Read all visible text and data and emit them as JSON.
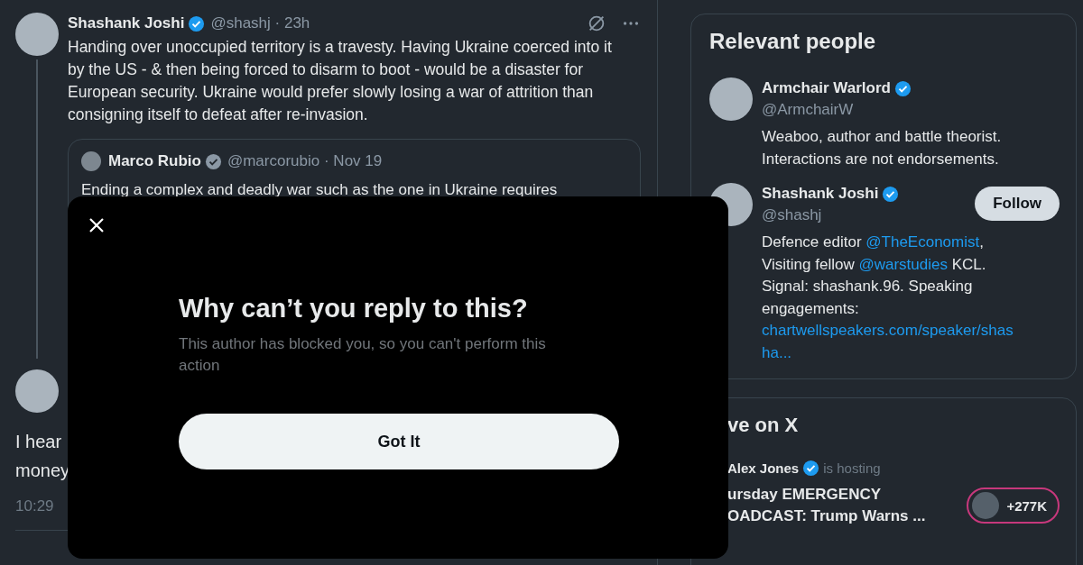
{
  "tweet": {
    "name": "Shashank Joshi",
    "verified": true,
    "meta": "@shashj · 23h",
    "text": "Handing over unoccupied territory is a travesty. Having Ukraine coerced into it by the US - & then being forced to disarm to boot - would be a disaster for European security. Ukraine would prefer slowly losing a war of attrition than consigning itself to defeat after re-invasion.",
    "quote": {
      "name": "Marco Rubio",
      "verified": true,
      "meta": "@marcorubio · Nov 19",
      "text": "Ending a complex and deadly war such as the one in Ukraine requires"
    }
  },
  "reply": {
    "lines": [
      "I hear",
      "money"
    ],
    "time": "10:29"
  },
  "relevant_people": {
    "title": "Relevant people",
    "people": [
      {
        "name": "Armchair Warlord",
        "verified": true,
        "handle": "@ArmchairW",
        "bio": [
          [
            {
              "kind": "text",
              "text": "Weaboo, author and battle theorist."
            }
          ],
          [
            {
              "kind": "text",
              "text": "Interactions are not endorsements."
            }
          ]
        ]
      },
      {
        "name": "Shashank Joshi",
        "verified": true,
        "handle": "@shashj",
        "button": "Follow",
        "bio": [
          [
            {
              "kind": "text",
              "text": "Defence editor "
            },
            {
              "kind": "link",
              "text": "@TheEconomist"
            },
            {
              "kind": "text",
              "text": ","
            }
          ],
          [
            {
              "kind": "text",
              "text": "Visiting fellow "
            },
            {
              "kind": "link",
              "text": "@warstudies"
            },
            {
              "kind": "text",
              "text": " KCL."
            }
          ],
          [
            {
              "kind": "text",
              "text": "Signal: shashank.96. Speaking"
            }
          ],
          [
            {
              "kind": "text",
              "text": "engagements:"
            }
          ],
          [
            {
              "kind": "link",
              "text": "chartwellspeakers.com/speaker/shas"
            }
          ],
          [
            {
              "kind": "link",
              "text": "ha..."
            }
          ]
        ]
      }
    ]
  },
  "live": {
    "title": "ve on X",
    "host": "Alex Jones",
    "verified": true,
    "status": "is hosting",
    "title_lines": [
      "ursday EMERGENCY",
      "OADCAST: Trump Warns ..."
    ],
    "listeners": "+277K"
  },
  "dialog": {
    "title": "Why can’t you reply to this?",
    "message": "This author has blocked you, so you can't perform this action",
    "button": "Got It"
  }
}
